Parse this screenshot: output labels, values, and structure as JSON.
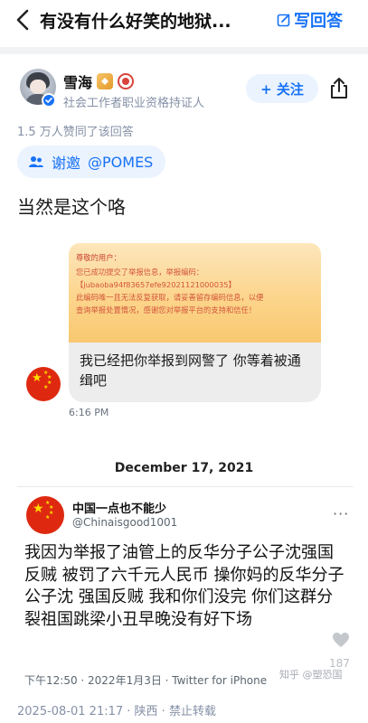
{
  "header": {
    "question_title": "有没有什么好笑的地狱...",
    "write_answer": "写回答"
  },
  "author": {
    "name": "雪海",
    "certification": "社会工作者职业资格持证人",
    "follow": "+ 关注"
  },
  "likes_text": "1.5 万人赞同了该回答",
  "invite": {
    "label": "谢邀",
    "mention": "@POMES"
  },
  "answer_text": "当然是这个咯",
  "screenshot1": {
    "notice_lines": [
      "尊敬的用户：",
      "您已成功提交了举报信息，举报编码：",
      "【jubaoba94f83657efe92021121000035】",
      "此编码唯一且无法反复获取，请妥善留存编码信息，以便",
      "查询举报处置情况，感谢您对举报平台的支持和信任！"
    ],
    "message": "我已经把你举报到网警了 你等着被通缉吧",
    "time": "6:16 PM",
    "date_label": "December 17, 2021"
  },
  "tweet": {
    "name": "中国一点也不能少",
    "handle": "@Chinaisgood1001",
    "more": "···",
    "text": "我因为举报了油管上的反华分子公子沈强国反贼 被罚了六千元人民币 操你妈的反华分子公子沈 强国反贼 我和你们没完 你们这群分裂祖国跳梁小丑早晚没有好下场",
    "meta": "下午12:50 · 2022年1月3日 · Twitter for iPhone",
    "like_count": "187",
    "watermark": "知乎 @塑恐国"
  },
  "footer": "2025-08-01 21:17 · 陕西 · 禁止转载",
  "colors": {
    "accent": "#1772f6",
    "accent_bg": "#ebf3ff",
    "muted": "#8590a6",
    "flag_red": "#de2910",
    "flag_star": "#ffde00"
  },
  "icons": [
    "back-icon",
    "edit-icon",
    "verified-icon",
    "share-icon",
    "invite-icon",
    "heart-icon"
  ]
}
